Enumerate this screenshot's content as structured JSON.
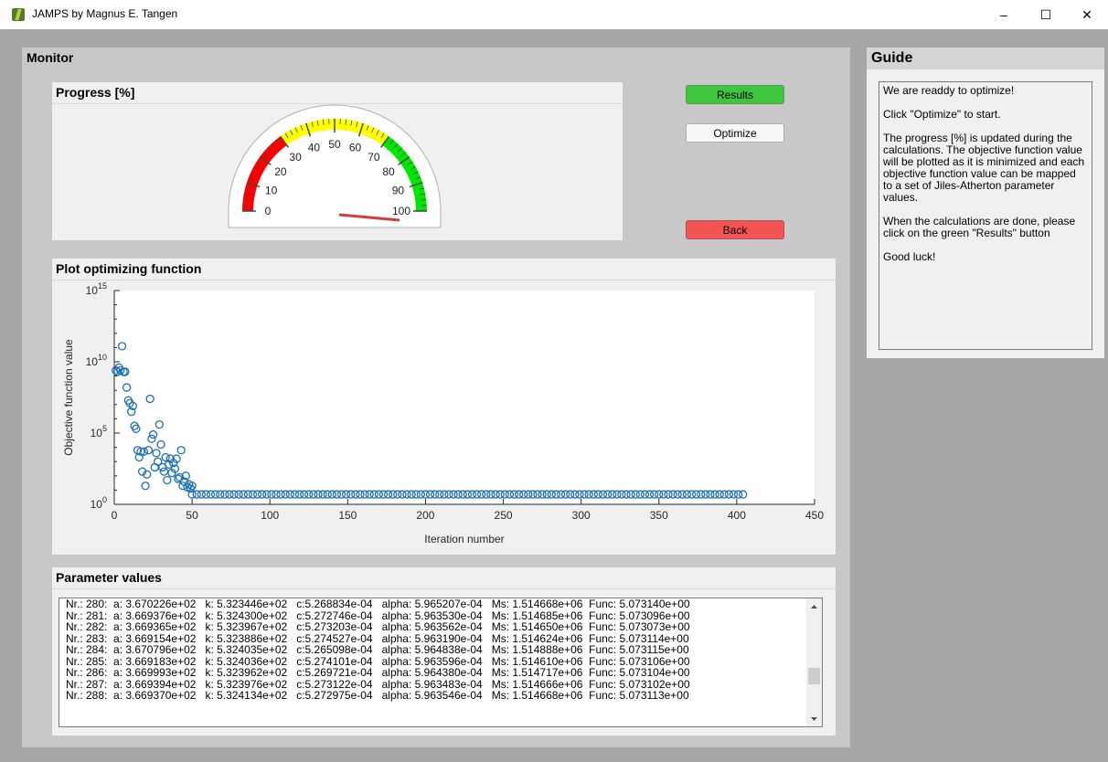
{
  "window": {
    "title": "JAMPS by Magnus E. Tangen",
    "minimize": "–",
    "maximize": "☐",
    "close": "✕"
  },
  "monitor": {
    "title": "Monitor",
    "progress": {
      "title": "Progress [%]",
      "ticks": [
        "0",
        "10",
        "20",
        "30",
        "40",
        "50",
        "60",
        "70",
        "80",
        "90",
        "100"
      ],
      "value_percent": 100
    },
    "buttons": {
      "results": "Results",
      "optimize": "Optimize",
      "back": "Back"
    },
    "plot": {
      "title": "Plot optimizing function"
    },
    "parameters": {
      "title": "Parameter values",
      "rows": [
        "Nr.: 280:  a: 3.670226e+02   k: 5.323446e+02   c:5.268834e-04   alpha: 5.965207e-04   Ms: 1.514668e+06  Func: 5.073140e+00",
        "Nr.: 281:  a: 3.669376e+02   k: 5.324300e+02   c:5.272746e-04   alpha: 5.963530e-04   Ms: 1.514685e+06  Func: 5.073096e+00",
        "Nr.: 282:  a: 3.669365e+02   k: 5.323967e+02   c:5.273203e-04   alpha: 5.963562e-04   Ms: 1.514650e+06  Func: 5.073073e+00",
        "Nr.: 283:  a: 3.669154e+02   k: 5.323886e+02   c:5.274527e-04   alpha: 5.963190e-04   Ms: 1.514624e+06  Func: 5.073114e+00",
        "Nr.: 284:  a: 3.670796e+02   k: 5.324035e+02   c:5.265098e-04   alpha: 5.964838e-04   Ms: 1.514888e+06  Func: 5.073115e+00",
        "Nr.: 285:  a: 3.669183e+02   k: 5.324036e+02   c:5.274101e-04   alpha: 5.963596e-04   Ms: 1.514610e+06  Func: 5.073106e+00",
        "Nr.: 286:  a: 3.669993e+02   k: 5.323962e+02   c:5.269721e-04   alpha: 5.964380e-04   Ms: 1.514717e+06  Func: 5.073104e+00",
        "Nr.: 287:  a: 3.669394e+02   k: 5.323976e+02   c:5.273122e-04   alpha: 5.963483e-04   Ms: 1.514666e+06  Func: 5.073102e+00",
        "Nr.: 288:  a: 3.669370e+02   k: 5.324134e+02   c:5.272975e-04   alpha: 5.963546e-04   Ms: 1.514668e+06  Func: 5.073113e+00"
      ]
    }
  },
  "guide": {
    "title": "Guide",
    "text": "We are readdy to optimize!\n\nClick \"Optimize\" to start.\n\nThe progress [%] is updated during the calculations. The objective function value will be plotted as it is minimized and each objective function value can be mapped to a set of Jiles-Atherton parameter values.\n\nWhen the calculations are done, please click on the green \"Results\" button\n\nGood luck!"
  },
  "colors": {
    "results_button": "#3ec63e",
    "back_button": "#f25454",
    "marker": "#1f6fb5",
    "gauge_red": "#ff0000",
    "gauge_yellow": "#ffff00",
    "gauge_green": "#00e600"
  },
  "chart_data": {
    "type": "scatter",
    "title": "",
    "xlabel": "Iteration number",
    "ylabel": "Objective function value",
    "yscale": "log",
    "xlim": [
      0,
      450
    ],
    "ylim_exponents": [
      0,
      15
    ],
    "xticks": [
      "0",
      "50",
      "100",
      "150",
      "200",
      "250",
      "300",
      "350",
      "400",
      "450"
    ],
    "yticks": [
      {
        "base": "10",
        "exp": "0"
      },
      {
        "base": "10",
        "exp": "5"
      },
      {
        "base": "10",
        "exp": "10"
      },
      {
        "base": "10",
        "exp": "15"
      }
    ],
    "early_points_log10": [
      [
        1,
        9.4
      ],
      [
        2,
        9.3
      ],
      [
        3,
        9.6
      ],
      [
        4,
        9.4
      ],
      [
        5,
        11.1
      ],
      [
        6,
        9.3
      ],
      [
        7,
        9.3
      ],
      [
        8,
        8.2
      ],
      [
        9,
        7.3
      ],
      [
        10,
        7.1
      ],
      [
        11,
        6.5
      ],
      [
        12,
        6.9
      ],
      [
        13,
        5.5
      ],
      [
        14,
        5.3
      ],
      [
        15,
        3.8
      ],
      [
        16,
        3.3
      ],
      [
        17,
        3.7
      ],
      [
        18,
        2.3
      ],
      [
        19,
        3.7
      ],
      [
        20,
        1.3
      ],
      [
        21,
        2.1
      ],
      [
        22,
        3.8
      ],
      [
        23,
        7.4
      ],
      [
        24,
        4.6
      ],
      [
        25,
        4.9
      ],
      [
        26,
        2.6
      ],
      [
        27,
        3.6
      ],
      [
        28,
        3.0
      ],
      [
        29,
        5.6
      ],
      [
        30,
        4.2
      ],
      [
        31,
        2.6
      ],
      [
        32,
        2.3
      ],
      [
        33,
        3.3
      ],
      [
        34,
        1.7
      ],
      [
        35,
        2.8
      ],
      [
        36,
        3.2
      ],
      [
        37,
        2.2
      ],
      [
        38,
        2.9
      ],
      [
        39,
        2.5
      ],
      [
        40,
        3.2
      ],
      [
        41,
        1.8
      ],
      [
        42,
        1.9
      ],
      [
        43,
        3.8
      ],
      [
        44,
        1.3
      ],
      [
        45,
        1.6
      ],
      [
        46,
        2.0
      ],
      [
        47,
        1.2
      ],
      [
        48,
        1.4
      ],
      [
        49,
        1.1
      ],
      [
        50,
        1.3
      ]
    ],
    "plateau": {
      "from": 50,
      "to": 405,
      "step": 3,
      "log10_value": 0.7
    }
  }
}
